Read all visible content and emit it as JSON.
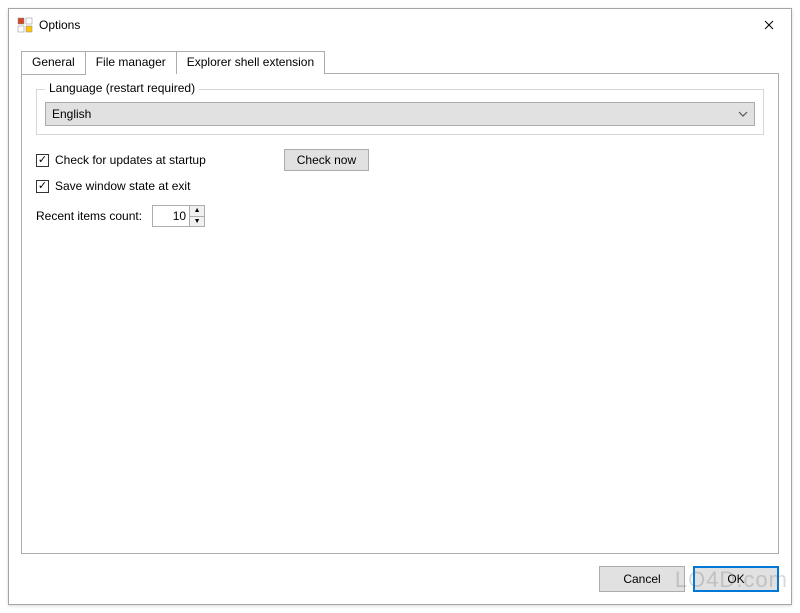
{
  "window": {
    "title": "Options"
  },
  "tabs": [
    {
      "label": "General",
      "active": true
    },
    {
      "label": "File manager",
      "active": false
    },
    {
      "label": "Explorer shell extension",
      "active": false
    }
  ],
  "language_group": {
    "legend": "Language (restart required)",
    "selected": "English"
  },
  "options": {
    "check_updates_label": "Check for updates at startup",
    "check_updates_checked": true,
    "check_now_label": "Check now",
    "save_window_label": "Save window state at exit",
    "save_window_checked": true,
    "recent_label": "Recent items count:",
    "recent_value": "10"
  },
  "footer": {
    "cancel": "Cancel",
    "ok": "OK"
  },
  "watermark": "LO4D.com"
}
